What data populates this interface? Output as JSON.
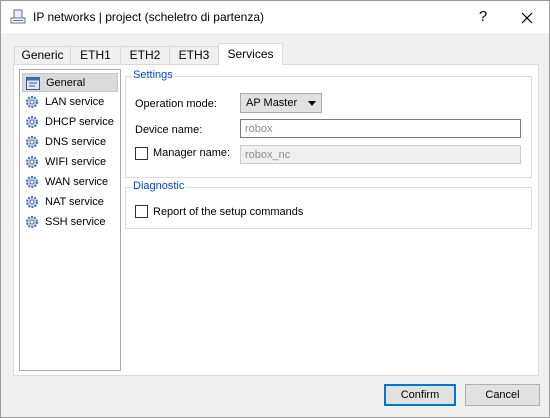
{
  "window": {
    "title": "IP networks | project (scheletro di partenza)",
    "help_label": "?"
  },
  "tabs": [
    {
      "label": "Generic"
    },
    {
      "label": "ETH1"
    },
    {
      "label": "ETH2"
    },
    {
      "label": "ETH3"
    },
    {
      "label": "Services",
      "active": true
    }
  ],
  "sidebar": {
    "items": [
      {
        "label": "General",
        "icon": "general-settings-icon",
        "selected": true
      },
      {
        "label": "LAN service",
        "icon": "gear-icon"
      },
      {
        "label": "DHCP service",
        "icon": "gear-icon"
      },
      {
        "label": "DNS service",
        "icon": "gear-icon"
      },
      {
        "label": "WIFI service",
        "icon": "gear-icon"
      },
      {
        "label": "WAN service",
        "icon": "gear-icon"
      },
      {
        "label": "NAT service",
        "icon": "gear-icon"
      },
      {
        "label": "SSH service",
        "icon": "gear-icon"
      }
    ]
  },
  "settings": {
    "title": "Settings",
    "operation_mode_label": "Operation mode:",
    "operation_mode_value": "AP Master",
    "device_name_label": "Device name:",
    "device_name_placeholder": "robox",
    "manager_name_label": "Manager name:",
    "manager_name_placeholder": "robox_nc"
  },
  "diagnostic": {
    "title": "Diagnostic",
    "report_label": "Report of the setup commands"
  },
  "footer": {
    "confirm_label": "Confirm",
    "cancel_label": "Cancel"
  },
  "colors": {
    "group_title": "#0046d5",
    "default_button_border": "#0078d7",
    "selected_item_bg": "#dadada"
  }
}
